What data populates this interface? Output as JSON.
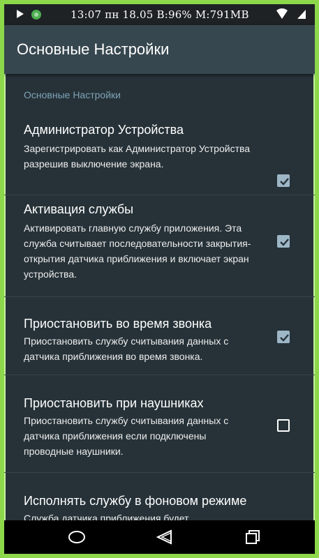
{
  "status_bar": {
    "text": "13:07 пн 18.05 B:96% M:791MB"
  },
  "app_bar": {
    "title": "Основные Настройки"
  },
  "section": {
    "header": "Основные Настройки"
  },
  "preferences": [
    {
      "title": "Администратор Устройства",
      "summary": "Зарегистрировать как Администратор Устройства разрешив выключение экрана.",
      "checked": true
    },
    {
      "title": "Активация службы",
      "summary": "Активировать главную службу приложения. Эта служба считывает последовательности закрытия-открытия датчика приближения и включает экран устройства.",
      "checked": true
    },
    {
      "title": "Приостановить во время звонка",
      "summary": "Приостановить службу считывания данных с датчика приближения во время звонка.",
      "checked": true
    },
    {
      "title": "Приостановить при наушниках",
      "summary": "Приостановить службу считывания данных с датчика приближения если подключены проводные наушники.",
      "checked": false
    },
    {
      "title": "Исполнять службу в фоновом режиме",
      "summary": "Служба датчика приближения будет"
    }
  ],
  "colors": {
    "background": "#263238",
    "app_bar": "#37474f",
    "accent": "#9eb7c7",
    "section_header": "#7ea3b5",
    "frame": "#8cd84a"
  },
  "icons": {
    "status_left": [
      "play-store-icon",
      "shield-icon"
    ],
    "status_right": [
      "wifi-icon",
      "signal-icon"
    ],
    "nav": [
      "home-icon",
      "back-icon",
      "recents-icon"
    ]
  }
}
